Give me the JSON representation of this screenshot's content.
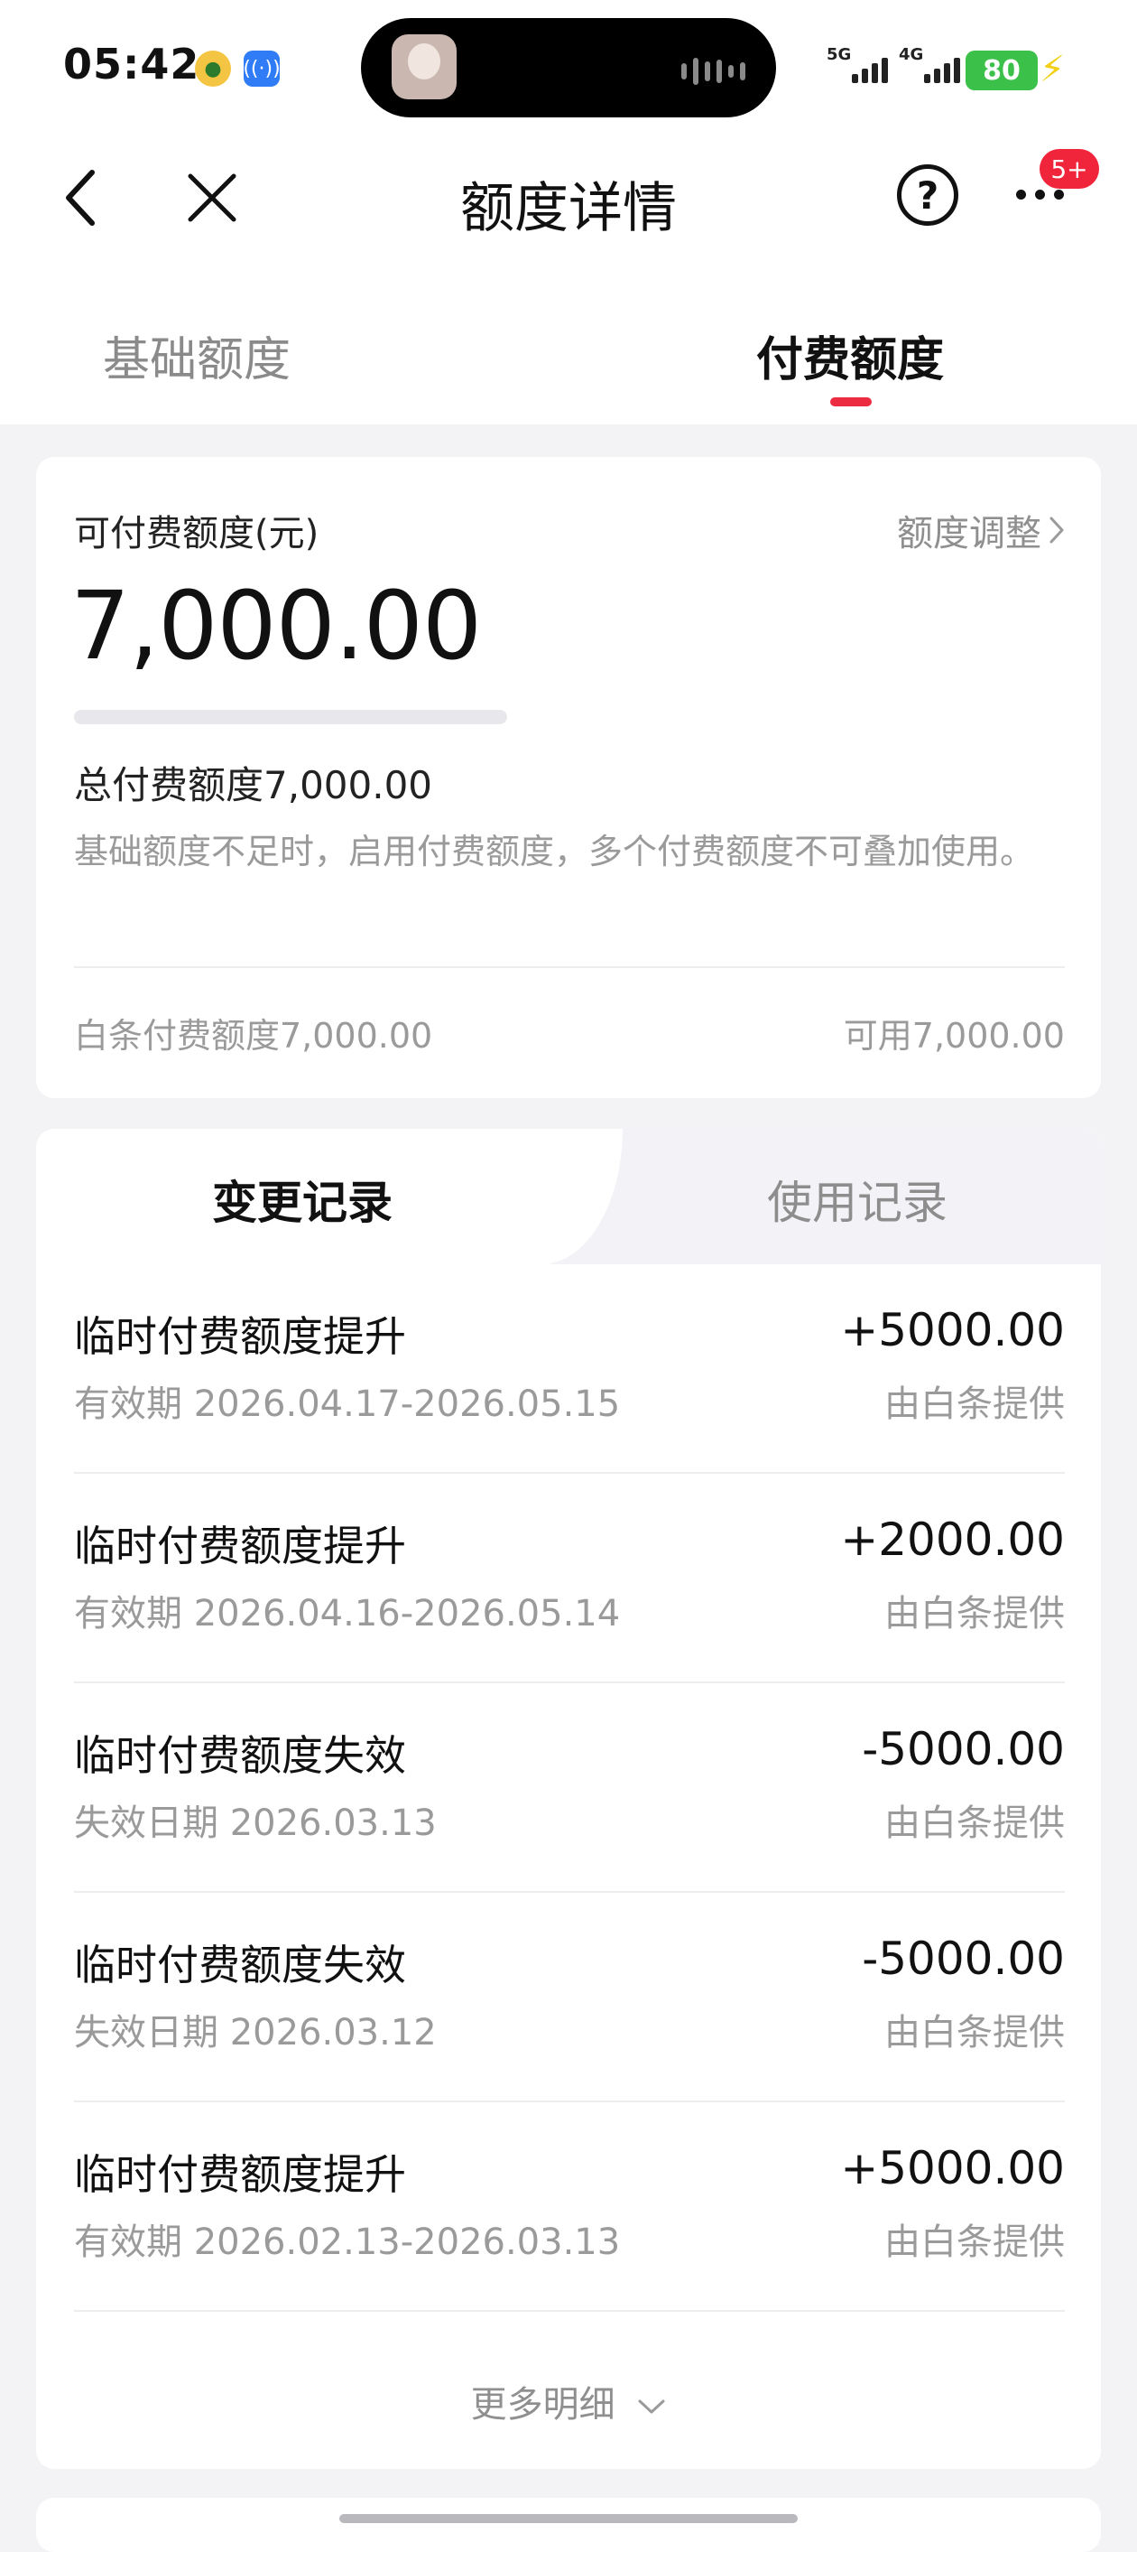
{
  "status_bar": {
    "time": "05:42",
    "network_1": "5G",
    "network_2": "4G",
    "battery": "80"
  },
  "nav": {
    "title": "额度详情",
    "more_badge": "5+"
  },
  "tabs": [
    {
      "label": "基础额度",
      "active": false
    },
    {
      "label": "付费额度",
      "active": true
    }
  ],
  "summary": {
    "available_label": "可付费额度(元)",
    "adjust_label": "额度调整",
    "available_amount": "7,000.00",
    "total_label": "总付费额度7,000.00",
    "description": "基础额度不足时，启用付费额度，多个付费额度不可叠加使用。",
    "source_label": "白条付费额度7,000.00",
    "usable_label": "可用7,000.00"
  },
  "records_tabs": [
    {
      "label": "变更记录",
      "active": true
    },
    {
      "label": "使用记录",
      "active": false
    }
  ],
  "records": [
    {
      "title": "临时付费额度提升",
      "sub": "有效期 2026.04.17-2026.05.15",
      "amount": "+5000.00",
      "source": "由白条提供"
    },
    {
      "title": "临时付费额度提升",
      "sub": "有效期 2026.04.16-2026.05.14",
      "amount": "+2000.00",
      "source": "由白条提供"
    },
    {
      "title": "临时付费额度失效",
      "sub": "失效日期 2026.03.13",
      "amount": "-5000.00",
      "source": "由白条提供"
    },
    {
      "title": "临时付费额度失效",
      "sub": "失效日期 2026.03.12",
      "amount": "-5000.00",
      "source": "由白条提供"
    },
    {
      "title": "临时付费额度提升",
      "sub": "有效期 2026.02.13-2026.03.13",
      "amount": "+5000.00",
      "source": "由白条提供"
    }
  ],
  "more_label": "更多明细",
  "colors": {
    "accent": "#ec2c40",
    "page_bg": "#f3f3f6",
    "muted_text": "#9a9a9a",
    "battery": "#3bc14a"
  }
}
